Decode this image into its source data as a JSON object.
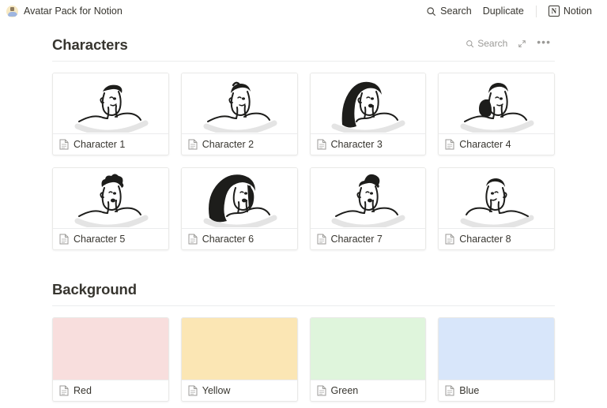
{
  "topbar": {
    "icon": "avatar-emoji-icon",
    "title": "Avatar Pack for Notion",
    "search_label": "Search",
    "search_icon": "search-icon",
    "duplicate_label": "Duplicate",
    "notion_label": "Notion",
    "notion_logo_letter": "N"
  },
  "sections": [
    {
      "id": "characters",
      "title": "Characters",
      "tools": {
        "search_label": "Search",
        "search_icon": "search-icon",
        "expand_icon": "expand-diagonal-icon",
        "more_icon": "more-options-icon",
        "more_label": "•••"
      },
      "items": [
        {
          "label": "Character 1",
          "icon": "page-document-icon",
          "art": "face-right-short-hair"
        },
        {
          "label": "Character 2",
          "icon": "page-document-icon",
          "art": "face-right-wavy-hair"
        },
        {
          "label": "Character 3",
          "icon": "page-document-icon",
          "art": "face-right-long-black-hair"
        },
        {
          "label": "Character 4",
          "icon": "page-document-icon",
          "art": "face-right-low-bun"
        },
        {
          "label": "Character 5",
          "icon": "page-document-icon",
          "art": "face-right-curly-hair"
        },
        {
          "label": "Character 6",
          "icon": "page-document-icon",
          "art": "face-right-voluminous-hair"
        },
        {
          "label": "Character 7",
          "icon": "page-document-icon",
          "art": "face-right-top-bun"
        },
        {
          "label": "Character 8",
          "icon": "page-document-icon",
          "art": "face-left-short-hair"
        }
      ]
    },
    {
      "id": "background",
      "title": "Background",
      "items": [
        {
          "label": "Red",
          "icon": "page-document-icon",
          "color": "#f8dedd"
        },
        {
          "label": "Yellow",
          "icon": "page-document-icon",
          "color": "#fbe6b4"
        },
        {
          "label": "Green",
          "icon": "page-document-icon",
          "color": "#dff5dc"
        },
        {
          "label": "Blue",
          "icon": "page-document-icon",
          "color": "#d8e6fa"
        }
      ]
    }
  ],
  "colors": {
    "text": "#37352f",
    "muted": "#9b9a97",
    "border": "#e9e9e7",
    "rule": "#ebeced",
    "background": "#ffffff",
    "ink": "#1d1d1b",
    "shadow_arc": "#e4e4e4"
  }
}
